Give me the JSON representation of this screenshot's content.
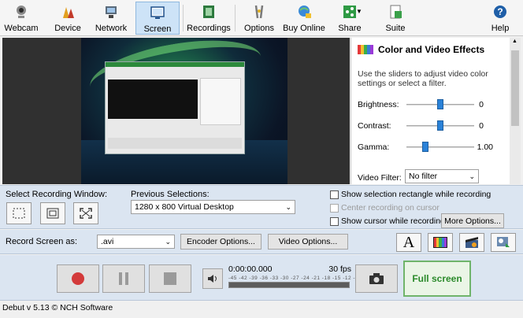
{
  "toolbar": {
    "items": [
      {
        "label": "Webcam",
        "icon": "webcam-icon"
      },
      {
        "label": "Device",
        "icon": "device-icon"
      },
      {
        "label": "Network",
        "icon": "network-icon"
      },
      {
        "label": "Screen",
        "icon": "screen-icon",
        "active": true
      },
      {
        "label": "Recordings",
        "icon": "recordings-icon"
      },
      {
        "label": "Options",
        "icon": "options-icon"
      },
      {
        "label": "Buy Online",
        "icon": "buy-online-icon"
      },
      {
        "label": "Share",
        "icon": "share-icon"
      },
      {
        "label": "Suite",
        "icon": "suite-icon"
      },
      {
        "label": "Help",
        "icon": "help-icon"
      }
    ]
  },
  "effects": {
    "title": "Color and Video Effects",
    "description": "Use the sliders to adjust video color settings or select a filter.",
    "brightness": {
      "label": "Brightness:",
      "value": "0",
      "level": 0.5
    },
    "contrast": {
      "label": "Contrast:",
      "value": "0",
      "level": 0.5
    },
    "gamma": {
      "label": "Gamma:",
      "value": "1.00",
      "level": 0.25
    },
    "filter": {
      "label": "Video Filter:",
      "value": "No filter"
    }
  },
  "selection": {
    "label": "Select Recording Window:",
    "previous_label": "Previous Selections:",
    "previous_value": "1280 x 800 Virtual Desktop",
    "show_rect": "Show selection rectangle while recording",
    "center_cursor": "Center recording on cursor",
    "show_cursor": "Show cursor while recording",
    "more_options": "More Options..."
  },
  "record": {
    "label": "Record Screen as:",
    "format": ".avi",
    "encoder_options": "Encoder Options...",
    "video_options": "Video Options..."
  },
  "meter": {
    "time": "0:00:00.000",
    "fps": "30 fps",
    "scale": "-45 -42 -39 -36 -33 -30 -27 -24 -21 -18 -15 -12 -9 -6 -3 0"
  },
  "fullscreen_label": "Full screen",
  "status": "Debut v 5.13 © NCH Software"
}
